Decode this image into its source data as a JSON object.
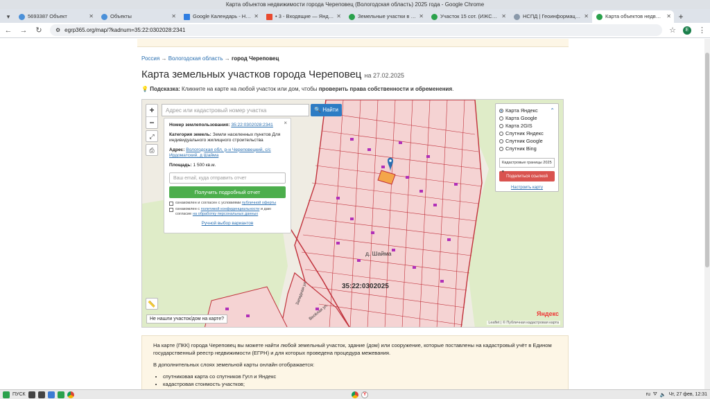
{
  "window": {
    "title": "Карта объектов недвижимости города Череповец (Вологодская область) 2025 года - Google Chrome"
  },
  "tabs": [
    {
      "title": "5693387 Объект",
      "icon": "globe-icon"
    },
    {
      "title": "Объекты",
      "icon": "globe-icon"
    },
    {
      "title": "Google Календарь - Неде",
      "icon": "calendar-icon"
    },
    {
      "title": "• 3 - Входящие — Яндекс",
      "icon": "mail-icon"
    },
    {
      "title": "Земельные участки в Чер",
      "icon": "green-icon"
    },
    {
      "title": "Участок 15 сот. (ИЖС) на",
      "icon": "green-icon"
    },
    {
      "title": "НСПД | Геоинформацион",
      "icon": "gray-icon"
    },
    {
      "title": "Карта объектов недвижи",
      "icon": "green-icon",
      "active": true
    }
  ],
  "address": {
    "url": "egrp365.org/map/?kadnum=35:22:0302028:2341",
    "profile_letter": "E"
  },
  "breadcrumb": {
    "item1": "Россия",
    "sep": "→",
    "item2": "Вологодская область",
    "item3": "город Череповец"
  },
  "page": {
    "title": "Карта земельных участков города Череповец",
    "date": "на 27.02.2025",
    "hint_label": "Подсказка:",
    "hint_text": "Кликните на карте на любой участок или дом, чтобы",
    "hint_bold": "проверить права собственности и обременения",
    "hint_end": "."
  },
  "map": {
    "search_placeholder": "Адрес или кадастровый номер участка",
    "find_label": "Найти",
    "zoom_in": "+",
    "zoom_out": "−",
    "not_found": "Не нашли участок/дом на карте?",
    "attribution": "Leaflet | © Публичная кадастровая карта",
    "yandex_logo": "Яндекс",
    "village_label": "д. Шайма",
    "cad_label": "35:22:0302025",
    "street1": "Весёлая ул.",
    "street2": "Западная ул."
  },
  "popup": {
    "close": "×",
    "num_label": "Номер землепользования:",
    "num_value": "35:22:0302028:2341",
    "category_label": "Категория земель:",
    "category_value": "Земли населенных пунктов Для индивидуального жилищного строительства",
    "address_label": "Адрес:",
    "address_value": "Вологодская обл, р-н Череповецкий, с/с Ирдоматский, д Шайма",
    "area_label": "Площадь:",
    "area_value": "1 500 кв.м.",
    "email_placeholder": "Ваш email, куда отправить отчет",
    "report_button": "Получить подробный отчет",
    "check1_text": "ознакомлен и согласен с условиями",
    "check1_link": "публичной оферты",
    "check2_text": "ознакомлен с",
    "check2_link": "политикой конфиденциальности",
    "check2_text2": "и даю согласие",
    "check2_link2": "на обработку персональных данных",
    "manual_link": "Ручной выбор вариантов"
  },
  "layers": {
    "options": [
      {
        "label": "Карта Яндекс",
        "selected": true
      },
      {
        "label": "Карта Google",
        "selected": false
      },
      {
        "label": "Карта 2GIS",
        "selected": false
      },
      {
        "label": "Спутник Яндекс",
        "selected": false
      },
      {
        "label": "Спутник Google",
        "selected": false
      },
      {
        "label": "Спутник Bing",
        "selected": false
      }
    ],
    "select_value": "Кадастровые границы 2025",
    "share_button": "Поделиться ссылкой",
    "setup_link": "Настроить карту"
  },
  "info": {
    "p1": "На карте (ПКК) города Череповец вы можете найти любой земельный участок, здание (дом) или сооружение, которые поставлены на кадастровый учёт в Едином государственный реестр недвижимости (ЕГРН) и для которых проведена процедура межевания.",
    "p2": "В дополнительных слоях земельной карты онлайн отображается:",
    "li1": "спутниковая карта со спутников Гугл и Яндекс",
    "li2": "кадастровая стоимость участков;"
  },
  "taskbar": {
    "start": "ПУСК",
    "lang": "ru",
    "clock": "Чт, 27 фев, 12:31"
  },
  "colors": {
    "accent": "#2d7cc4",
    "parcel_fill": "#f3c9c9",
    "parcel_line": "#c0303a",
    "selected_parcel": "#f4a64a"
  }
}
